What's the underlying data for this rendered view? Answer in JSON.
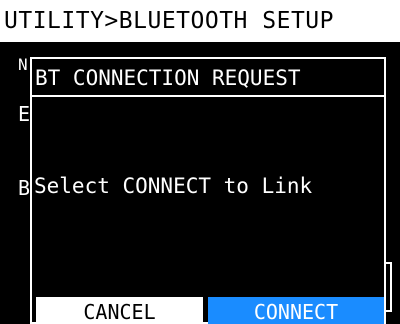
{
  "header": {
    "title": "UTILITY>BLUETOOTH SETUP"
  },
  "background": {
    "frag_n": "N",
    "frag_e": "E",
    "frag_b": "B"
  },
  "dialog": {
    "title": "BT CONNECTION REQUEST",
    "message": "Select CONNECT to Link",
    "cancel_label": "CANCEL",
    "connect_label": "CONNECT"
  },
  "colors": {
    "background": "#000000",
    "foreground": "#ffffff",
    "selected_button": "#1a8cff"
  }
}
